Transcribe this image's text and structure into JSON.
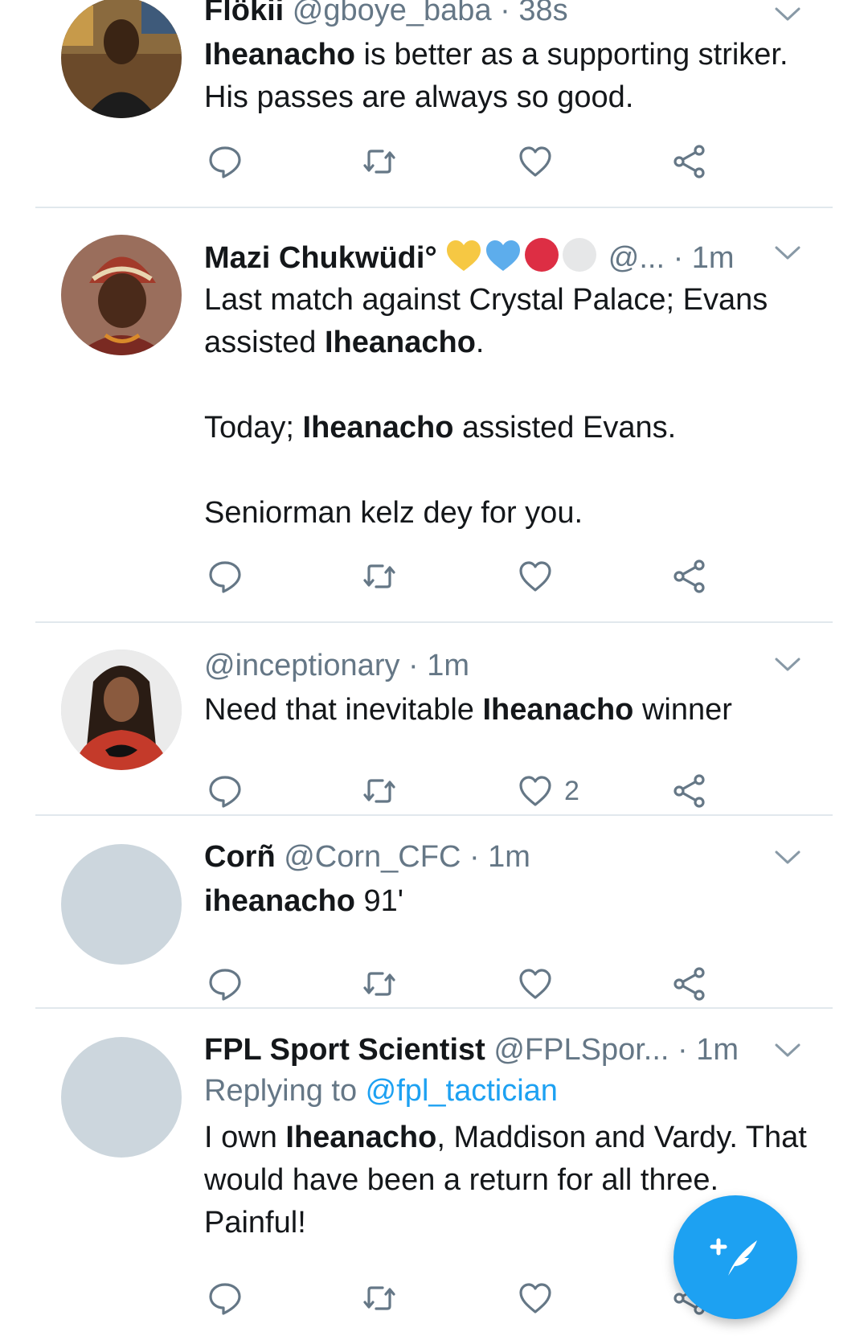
{
  "colors": {
    "accent": "#1da1f2",
    "text": "#14171a",
    "muted": "#657786",
    "divider": "#e1e8ed"
  },
  "tweets": [
    {
      "name": "Flökii",
      "handle": "@gboye_baba",
      "sep": "·",
      "time": "38s",
      "body": [
        {
          "b": "Iheanacho"
        },
        {
          "t": " is better as a supporting striker. His passes are always so good."
        }
      ],
      "likes": ""
    },
    {
      "name": "Mazi Chukwüdi°",
      "emoji_icons": [
        "yellow-heart-icon",
        "blue-heart-icon",
        "red-circle-icon",
        "white-circle-icon"
      ],
      "handle": "@...",
      "sep": "·",
      "time": "1m",
      "body": [
        {
          "t": "Last match against Crystal Palace; Evans assisted "
        },
        {
          "b": "Iheanacho"
        },
        {
          "t": ".\n\nToday; "
        },
        {
          "b": "Iheanacho"
        },
        {
          "t": " assisted Evans.\n\nSeniorman kelz dey for you."
        }
      ],
      "likes": ""
    },
    {
      "name": "",
      "handle": "@inceptionary",
      "sep": "·",
      "time": "1m",
      "body": [
        {
          "t": "Need that inevitable "
        },
        {
          "b": "Iheanacho"
        },
        {
          "t": " winner"
        }
      ],
      "likes": "2"
    },
    {
      "name": "Corñ",
      "handle": "@Corn_CFC",
      "sep": "·",
      "time": "1m",
      "body": [
        {
          "b": "iheanacho"
        },
        {
          "t": " 91'"
        }
      ],
      "likes": ""
    },
    {
      "name": "FPL Sport Scientist",
      "handle": "@FPLSpor...",
      "sep": "·",
      "time": "1m",
      "replying_prefix": "Replying to ",
      "replying_to": "@fpl_tactician",
      "body": [
        {
          "t": "I own "
        },
        {
          "b": "Iheanacho"
        },
        {
          "t": ", Maddison and Vardy. That would have been a return for all three. Painful!"
        }
      ],
      "likes": ""
    }
  ],
  "icons": {
    "reply": "reply-icon",
    "retweet": "retweet-icon",
    "like": "heart-icon",
    "share": "share-icon",
    "menu": "chevron-down-icon",
    "compose": "compose-tweet-icon"
  }
}
